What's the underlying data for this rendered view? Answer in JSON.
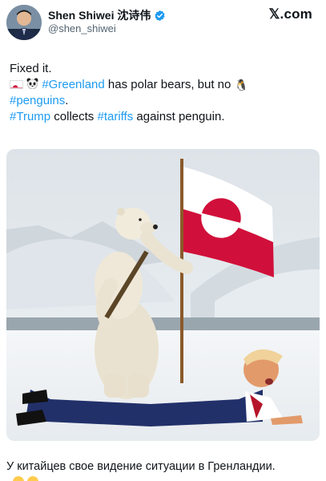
{
  "header": {
    "display_name": "Shen Shiwei 沈诗伟",
    "handle": "@shen_shiwei",
    "brand": "𝕏.com",
    "avatar_icon": "profile-photo",
    "verified_icon": "verified-badge-icon"
  },
  "tweet": {
    "line1": "Fixed it.",
    "line2_emojis": [
      "greenland-flag",
      "panda-face"
    ],
    "hashtag_greenland": "#Greenland",
    "line2_rest": " has polar bears, but no ",
    "penguin_emoji": "🐧",
    "hashtag_penguins": "#penguins",
    "line3_end": ".",
    "hashtag_trump": "#Trump",
    "line4_mid": " collects ",
    "hashtag_tariffs": "#tariffs",
    "line4_rest": " against penguin."
  },
  "media": {
    "description_icon": "ai-image-polar-bear-flag",
    "flag_colors": {
      "red": "#d0103a",
      "white": "#ffffff"
    }
  },
  "comment": {
    "text": "У китайцев свое видение ситуации в Гренландии."
  },
  "colors": {
    "link": "#1d9bf0",
    "text": "#0f1419",
    "secondary": "#536471",
    "verified": "#1d9bf0"
  }
}
